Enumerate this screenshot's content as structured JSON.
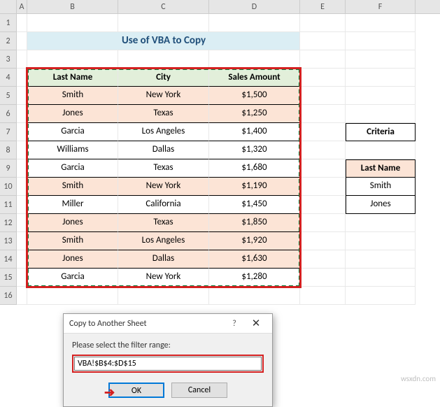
{
  "columns": [
    "A",
    "B",
    "C",
    "D",
    "E",
    "F"
  ],
  "rows": [
    "1",
    "2",
    "3",
    "4",
    "5",
    "6",
    "7",
    "8",
    "9",
    "10",
    "11",
    "12",
    "13",
    "14",
    "15",
    "16"
  ],
  "title": "Use of VBA to Copy",
  "headers": {
    "b": "Last Name",
    "c": "City",
    "d": "Sales Amount"
  },
  "table": [
    {
      "b": "Smith",
      "c": "New York",
      "d": "$1,500",
      "hl": true
    },
    {
      "b": "Jones",
      "c": "Texas",
      "d": "$1,250",
      "hl": true
    },
    {
      "b": "Garcia",
      "c": "Los Angeles",
      "d": "$1,400",
      "hl": false
    },
    {
      "b": "Williams",
      "c": "Dallas",
      "d": "$1,320",
      "hl": false
    },
    {
      "b": "Garcia",
      "c": "Texas",
      "d": "$1,680",
      "hl": false
    },
    {
      "b": "Smith",
      "c": "New York",
      "d": "$1,190",
      "hl": true
    },
    {
      "b": "Miller",
      "c": "California",
      "d": "$1,450",
      "hl": false
    },
    {
      "b": "Jones",
      "c": "Texas",
      "d": "$1,850",
      "hl": true
    },
    {
      "b": "Smith",
      "c": "Los Angeles",
      "d": "$1,920",
      "hl": true
    },
    {
      "b": "Jones",
      "c": "Dallas",
      "d": "$1,630",
      "hl": true
    },
    {
      "b": "Garcia",
      "c": "New York",
      "d": "$1,280",
      "hl": false
    }
  ],
  "criteria": {
    "label": "Criteria",
    "header": "Last Name",
    "values": [
      "Smith",
      "Jones"
    ]
  },
  "dialog": {
    "title": "Copy to Another Sheet",
    "help": "?",
    "close": "✕",
    "label": "Please select the filter range:",
    "value": "VBA!$B$4:$D$15",
    "ok": "OK",
    "cancel": "Cancel"
  },
  "watermark": "wsxdn.com",
  "chart_data": {
    "type": "table",
    "title": "Use of VBA to Copy",
    "columns": [
      "Last Name",
      "City",
      "Sales Amount"
    ],
    "rows": [
      [
        "Smith",
        "New York",
        1500
      ],
      [
        "Jones",
        "Texas",
        1250
      ],
      [
        "Garcia",
        "Los Angeles",
        1400
      ],
      [
        "Williams",
        "Dallas",
        1320
      ],
      [
        "Garcia",
        "Texas",
        1680
      ],
      [
        "Smith",
        "New York",
        1190
      ],
      [
        "Miller",
        "California",
        1450
      ],
      [
        "Jones",
        "Texas",
        1850
      ],
      [
        "Smith",
        "Los Angeles",
        1920
      ],
      [
        "Jones",
        "Dallas",
        1630
      ],
      [
        "Garcia",
        "New York",
        1280
      ]
    ],
    "criteria": {
      "column": "Last Name",
      "values": [
        "Smith",
        "Jones"
      ]
    },
    "selected_range": "VBA!$B$4:$D$15"
  }
}
